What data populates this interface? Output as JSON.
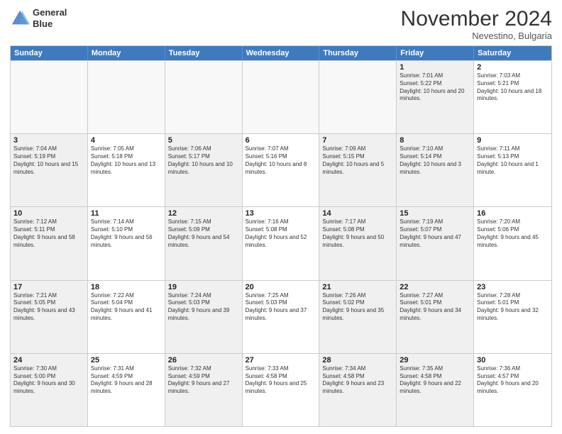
{
  "header": {
    "logo_line1": "General",
    "logo_line2": "Blue",
    "month_year": "November 2024",
    "location": "Nevestino, Bulgaria"
  },
  "days_of_week": [
    "Sunday",
    "Monday",
    "Tuesday",
    "Wednesday",
    "Thursday",
    "Friday",
    "Saturday"
  ],
  "rows": [
    [
      {
        "day": "",
        "info": "",
        "empty": true
      },
      {
        "day": "",
        "info": "",
        "empty": true
      },
      {
        "day": "",
        "info": "",
        "empty": true
      },
      {
        "day": "",
        "info": "",
        "empty": true
      },
      {
        "day": "",
        "info": "",
        "empty": true
      },
      {
        "day": "1",
        "info": "Sunrise: 7:01 AM\nSunset: 5:22 PM\nDaylight: 10 hours and 20 minutes.",
        "shaded": true
      },
      {
        "day": "2",
        "info": "Sunrise: 7:03 AM\nSunset: 5:21 PM\nDaylight: 10 hours and 18 minutes."
      }
    ],
    [
      {
        "day": "3",
        "info": "Sunrise: 7:04 AM\nSunset: 5:19 PM\nDaylight: 10 hours and 15 minutes.",
        "shaded": true
      },
      {
        "day": "4",
        "info": "Sunrise: 7:05 AM\nSunset: 5:18 PM\nDaylight: 10 hours and 13 minutes."
      },
      {
        "day": "5",
        "info": "Sunrise: 7:06 AM\nSunset: 5:17 PM\nDaylight: 10 hours and 10 minutes.",
        "shaded": true
      },
      {
        "day": "6",
        "info": "Sunrise: 7:07 AM\nSunset: 5:16 PM\nDaylight: 10 hours and 8 minutes."
      },
      {
        "day": "7",
        "info": "Sunrise: 7:09 AM\nSunset: 5:15 PM\nDaylight: 10 hours and 5 minutes.",
        "shaded": true
      },
      {
        "day": "8",
        "info": "Sunrise: 7:10 AM\nSunset: 5:14 PM\nDaylight: 10 hours and 3 minutes.",
        "shaded": true
      },
      {
        "day": "9",
        "info": "Sunrise: 7:11 AM\nSunset: 5:13 PM\nDaylight: 10 hours and 1 minute."
      }
    ],
    [
      {
        "day": "10",
        "info": "Sunrise: 7:12 AM\nSunset: 5:11 PM\nDaylight: 9 hours and 58 minutes.",
        "shaded": true
      },
      {
        "day": "11",
        "info": "Sunrise: 7:14 AM\nSunset: 5:10 PM\nDaylight: 9 hours and 56 minutes."
      },
      {
        "day": "12",
        "info": "Sunrise: 7:15 AM\nSunset: 5:09 PM\nDaylight: 9 hours and 54 minutes.",
        "shaded": true
      },
      {
        "day": "13",
        "info": "Sunrise: 7:16 AM\nSunset: 5:08 PM\nDaylight: 9 hours and 52 minutes."
      },
      {
        "day": "14",
        "info": "Sunrise: 7:17 AM\nSunset: 5:08 PM\nDaylight: 9 hours and 50 minutes.",
        "shaded": true
      },
      {
        "day": "15",
        "info": "Sunrise: 7:19 AM\nSunset: 5:07 PM\nDaylight: 9 hours and 47 minutes.",
        "shaded": true
      },
      {
        "day": "16",
        "info": "Sunrise: 7:20 AM\nSunset: 5:06 PM\nDaylight: 9 hours and 45 minutes."
      }
    ],
    [
      {
        "day": "17",
        "info": "Sunrise: 7:21 AM\nSunset: 5:05 PM\nDaylight: 9 hours and 43 minutes.",
        "shaded": true
      },
      {
        "day": "18",
        "info": "Sunrise: 7:22 AM\nSunset: 5:04 PM\nDaylight: 9 hours and 41 minutes."
      },
      {
        "day": "19",
        "info": "Sunrise: 7:24 AM\nSunset: 5:03 PM\nDaylight: 9 hours and 39 minutes.",
        "shaded": true
      },
      {
        "day": "20",
        "info": "Sunrise: 7:25 AM\nSunset: 5:03 PM\nDaylight: 9 hours and 37 minutes."
      },
      {
        "day": "21",
        "info": "Sunrise: 7:26 AM\nSunset: 5:02 PM\nDaylight: 9 hours and 35 minutes.",
        "shaded": true
      },
      {
        "day": "22",
        "info": "Sunrise: 7:27 AM\nSunset: 5:01 PM\nDaylight: 9 hours and 34 minutes.",
        "shaded": true
      },
      {
        "day": "23",
        "info": "Sunrise: 7:28 AM\nSunset: 5:01 PM\nDaylight: 9 hours and 32 minutes."
      }
    ],
    [
      {
        "day": "24",
        "info": "Sunrise: 7:30 AM\nSunset: 5:00 PM\nDaylight: 9 hours and 30 minutes.",
        "shaded": true
      },
      {
        "day": "25",
        "info": "Sunrise: 7:31 AM\nSunset: 4:59 PM\nDaylight: 9 hours and 28 minutes."
      },
      {
        "day": "26",
        "info": "Sunrise: 7:32 AM\nSunset: 4:59 PM\nDaylight: 9 hours and 27 minutes.",
        "shaded": true
      },
      {
        "day": "27",
        "info": "Sunrise: 7:33 AM\nSunset: 4:58 PM\nDaylight: 9 hours and 25 minutes."
      },
      {
        "day": "28",
        "info": "Sunrise: 7:34 AM\nSunset: 4:58 PM\nDaylight: 9 hours and 23 minutes.",
        "shaded": true
      },
      {
        "day": "29",
        "info": "Sunrise: 7:35 AM\nSunset: 4:58 PM\nDaylight: 9 hours and 22 minutes.",
        "shaded": true
      },
      {
        "day": "30",
        "info": "Sunrise: 7:36 AM\nSunset: 4:57 PM\nDaylight: 9 hours and 20 minutes."
      }
    ]
  ]
}
